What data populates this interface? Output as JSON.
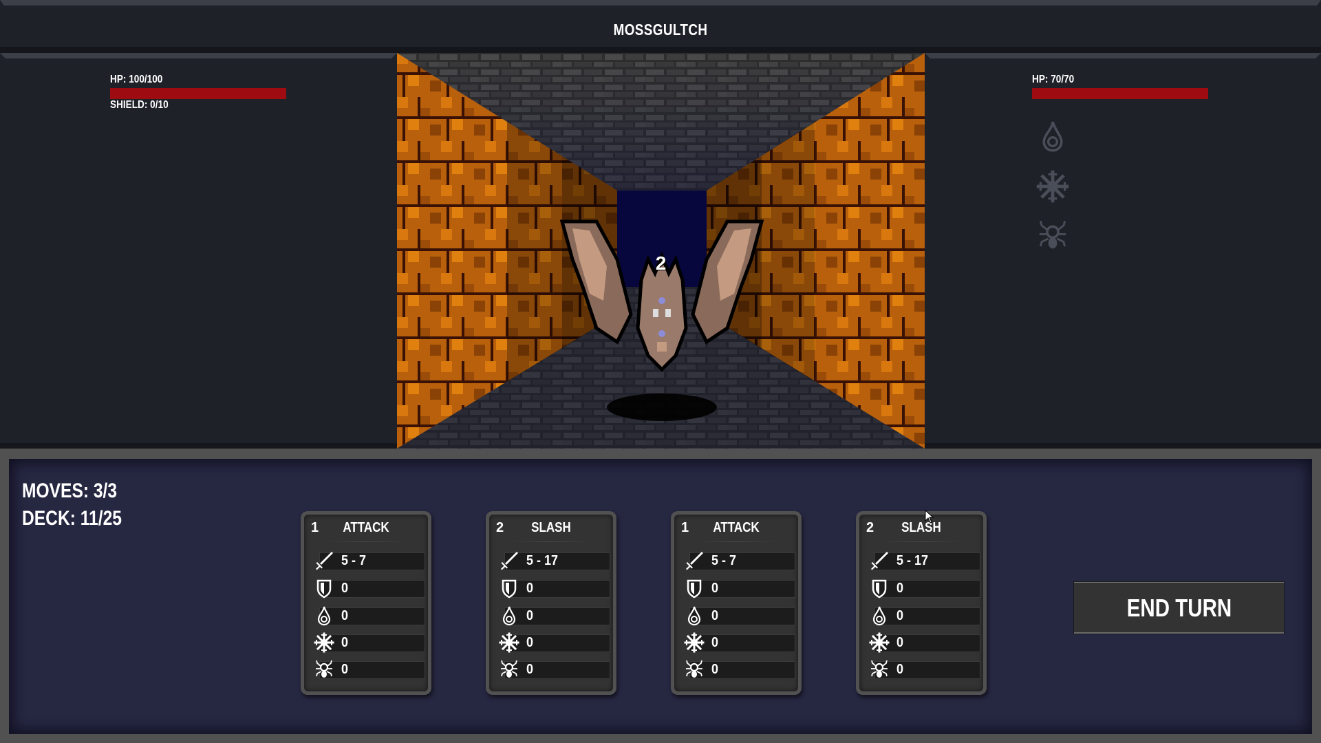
{
  "header": {
    "title": "MOSSGULTCH"
  },
  "player": {
    "hp_label": "HP: 100/100",
    "hp_current": 100,
    "hp_max": 100,
    "shield_label": "SHIELD: 0/10",
    "shield_current": 0,
    "shield_max": 10
  },
  "enemy": {
    "hp_label": "HP: 70/70",
    "hp_current": 70,
    "hp_max": 70,
    "count_label": "2",
    "status_icons": [
      "fire-icon",
      "frost-icon",
      "poison-spider-icon"
    ]
  },
  "colors": {
    "hp_bar": "#9e0b10",
    "panel_bg": "#1f2129",
    "hand_bg": "#262741",
    "frame": "#515151",
    "card_bg": "#333333",
    "wall_orange": "#c8640a"
  },
  "hand": {
    "moves_label": "MOVES: 3/3",
    "deck_label": "DECK: 11/25",
    "end_turn_label": "END TURN",
    "cards": [
      {
        "cost": "1",
        "name": "ATTACK",
        "stats": {
          "damage": "5 - 7",
          "shield": "0",
          "fire": "0",
          "frost": "0",
          "poison": "0"
        }
      },
      {
        "cost": "2",
        "name": "SLASH",
        "stats": {
          "damage": "5 - 17",
          "shield": "0",
          "fire": "0",
          "frost": "0",
          "poison": "0"
        }
      },
      {
        "cost": "1",
        "name": "ATTACK",
        "stats": {
          "damage": "5 - 7",
          "shield": "0",
          "fire": "0",
          "frost": "0",
          "poison": "0"
        }
      },
      {
        "cost": "2",
        "name": "SLASH",
        "stats": {
          "damage": "5 - 17",
          "shield": "0",
          "fire": "0",
          "frost": "0",
          "poison": "0"
        }
      }
    ],
    "stat_icons": [
      "sword-icon",
      "shield-icon",
      "fire-icon",
      "frost-icon",
      "poison-spider-icon"
    ]
  }
}
